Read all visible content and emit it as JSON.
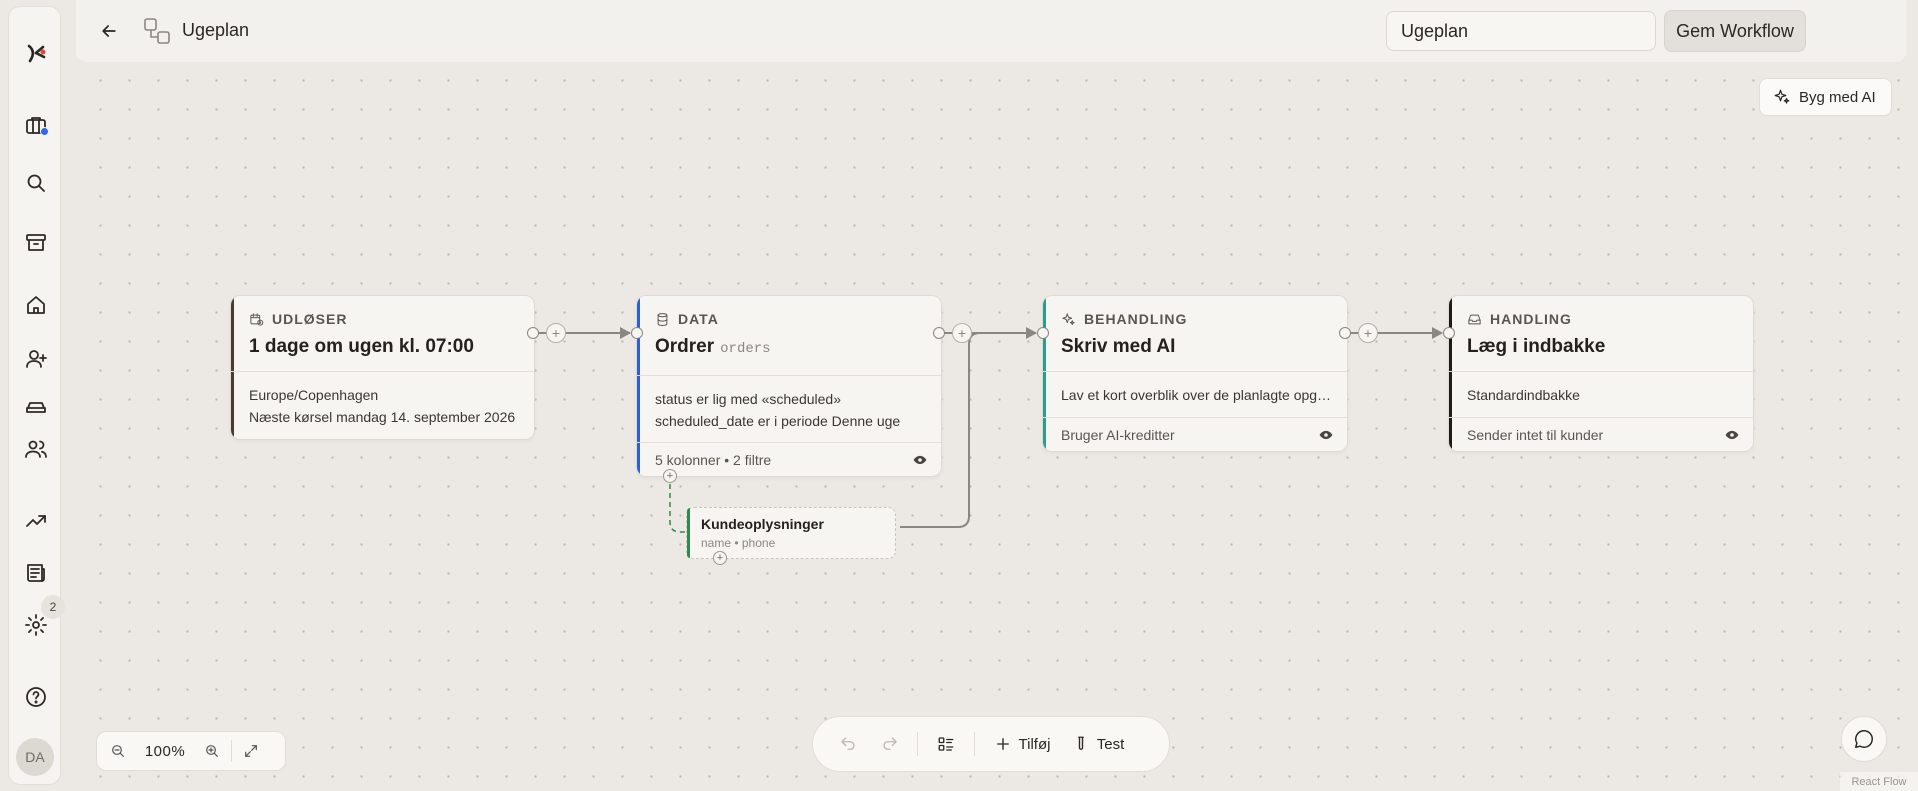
{
  "header": {
    "title": "Ugeplan",
    "workflow_name_value": "Ugeplan",
    "save_label": "Gem Workflow"
  },
  "sidebar": {
    "items": [
      {
        "icon": "logo-icon"
      },
      {
        "icon": "briefcase-icon",
        "has_dot": true
      },
      {
        "icon": "search-icon"
      },
      {
        "icon": "archive-icon"
      },
      {
        "icon": "home-icon"
      },
      {
        "icon": "user-plus-icon"
      },
      {
        "icon": "vehicle-icon"
      },
      {
        "icon": "users-icon"
      },
      {
        "icon": "trending-up-icon"
      },
      {
        "icon": "newspaper-icon"
      },
      {
        "icon": "gear-icon"
      },
      {
        "icon": "help-icon"
      }
    ],
    "settings_badge": "2",
    "avatar_initials": "DA"
  },
  "canvas": {
    "ai_button_label": "Byg med AI",
    "nodes": {
      "trigger": {
        "kind": "UDLØSER",
        "title": "1 dage om ugen kl. 07:00",
        "lines": [
          "Europe/Copenhagen",
          "Næste kørsel mandag 14. september 2026"
        ]
      },
      "data": {
        "kind": "DATA",
        "title": "Ordrer",
        "source": "orders",
        "lines": [
          "status er lig med «scheduled»",
          "scheduled_date er i periode Denne uge"
        ],
        "footer": "5 kolonner • 2 filtre"
      },
      "process": {
        "kind": "BEHANDLING",
        "title": "Skriv med AI",
        "lines": [
          "Lav et kort overblik over de planlagte opgaver"
        ],
        "footer": "Bruger AI-kreditter"
      },
      "action": {
        "kind": "HANDLING",
        "title": "Læg i indbakke",
        "lines": [
          "Standardindbakke"
        ],
        "footer": "Sender intet til kunder"
      },
      "join": {
        "title": "Kundeoplysninger",
        "columns": "name • phone"
      }
    },
    "accent_colors": {
      "trigger": "#4a3b36",
      "data": "#2d5fd0",
      "process": "#2a9d8f",
      "action": "#1e1b19",
      "join": "#2f8a4a"
    }
  },
  "zoom": {
    "level": "100%"
  },
  "toolbar": {
    "add_label": "Tilføj",
    "test_label": "Test"
  },
  "attribution": "React Flow"
}
